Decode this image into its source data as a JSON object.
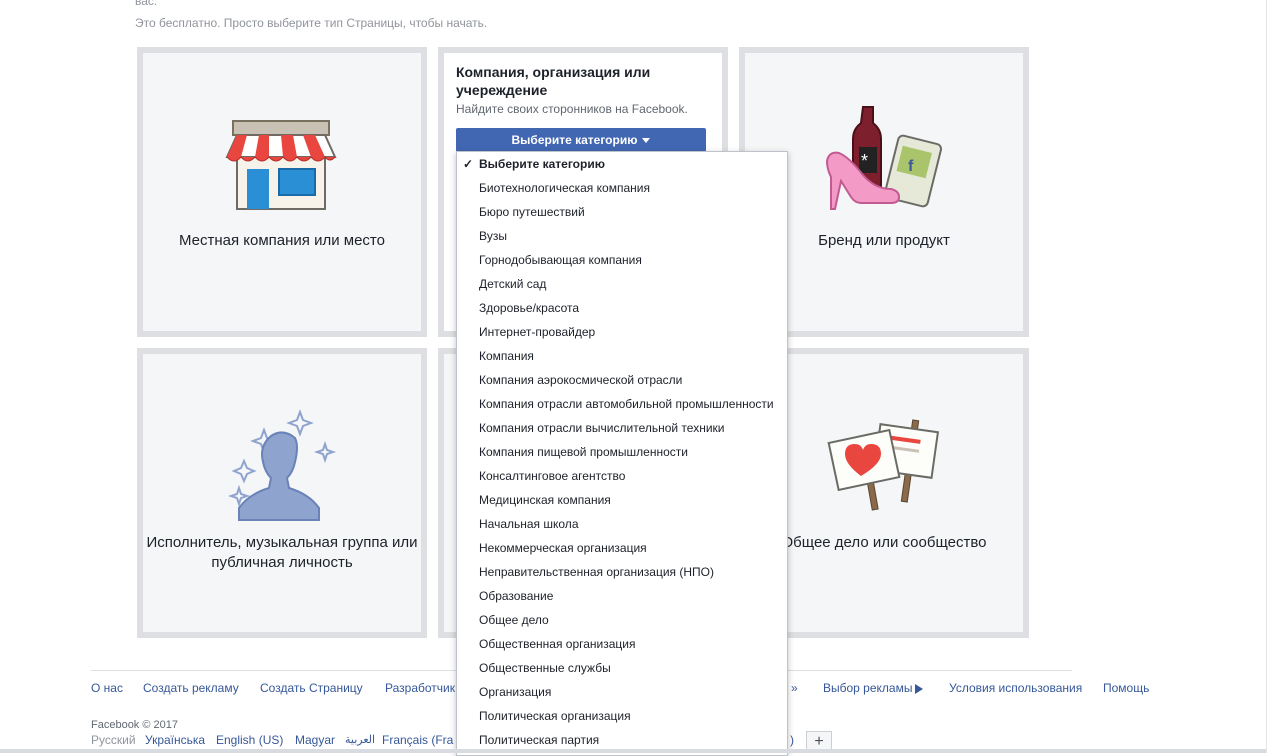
{
  "header": {
    "top_cut": "вас.",
    "intro": "Это бесплатно. Просто выберите тип Страницы, чтобы начать."
  },
  "tiles": {
    "local": {
      "label": "Местная компания или место"
    },
    "company": {
      "title": "Компания, организация или учереждение",
      "subtitle": "Найдите своих сторонников на Facebook.",
      "button_label": "Выберите категорию"
    },
    "brand": {
      "label": "Бренд или продукт"
    },
    "artist": {
      "label_line1": "Исполнитель, музыкальная группа или",
      "label_line2": "публичная личность"
    },
    "cause": {
      "label": "Общее дело или сообщество"
    }
  },
  "dropdown": {
    "selected": "Выберите категорию",
    "items": [
      "Биотехнологическая компания",
      "Бюро путешествий",
      "Вузы",
      "Горнодобывающая компания",
      "Детский сад",
      "Здоровье/красота",
      "Интернет-провайдер",
      "Компания",
      "Компания аэрокосмической отрасли",
      "Компания отрасли автомобильной промышленности",
      "Компания отрасли вычислительной техники",
      "Компания пищевой промышленности",
      "Консалтинговое агентство",
      "Медицинская компания",
      "Начальная школа",
      "Некоммерческая организация",
      "Неправительственная организация (НПО)",
      "Образование",
      "Общее дело",
      "Общественная организация",
      "Общественные службы",
      "Организация",
      "Политическая организация",
      "Политическая партия"
    ]
  },
  "footer": {
    "links": [
      "О нас",
      "Создать рекламу",
      "Создать Страницу",
      "Разработчик",
      "»",
      "Выбор рекламы",
      "Условия использования",
      "Помощь"
    ],
    "copyright": "Facebook © 2017",
    "languages": {
      "current": "Русский",
      "others": [
        "Українська",
        "English (US)",
        "Magyar",
        "العربية",
        "Français (Fra",
        ")"
      ]
    },
    "plus": "+"
  },
  "colors": {
    "brand_blue": "#4267b2",
    "link": "#365899",
    "tile_bg": "#f5f6f7",
    "tile_border": "#dddfe2"
  }
}
